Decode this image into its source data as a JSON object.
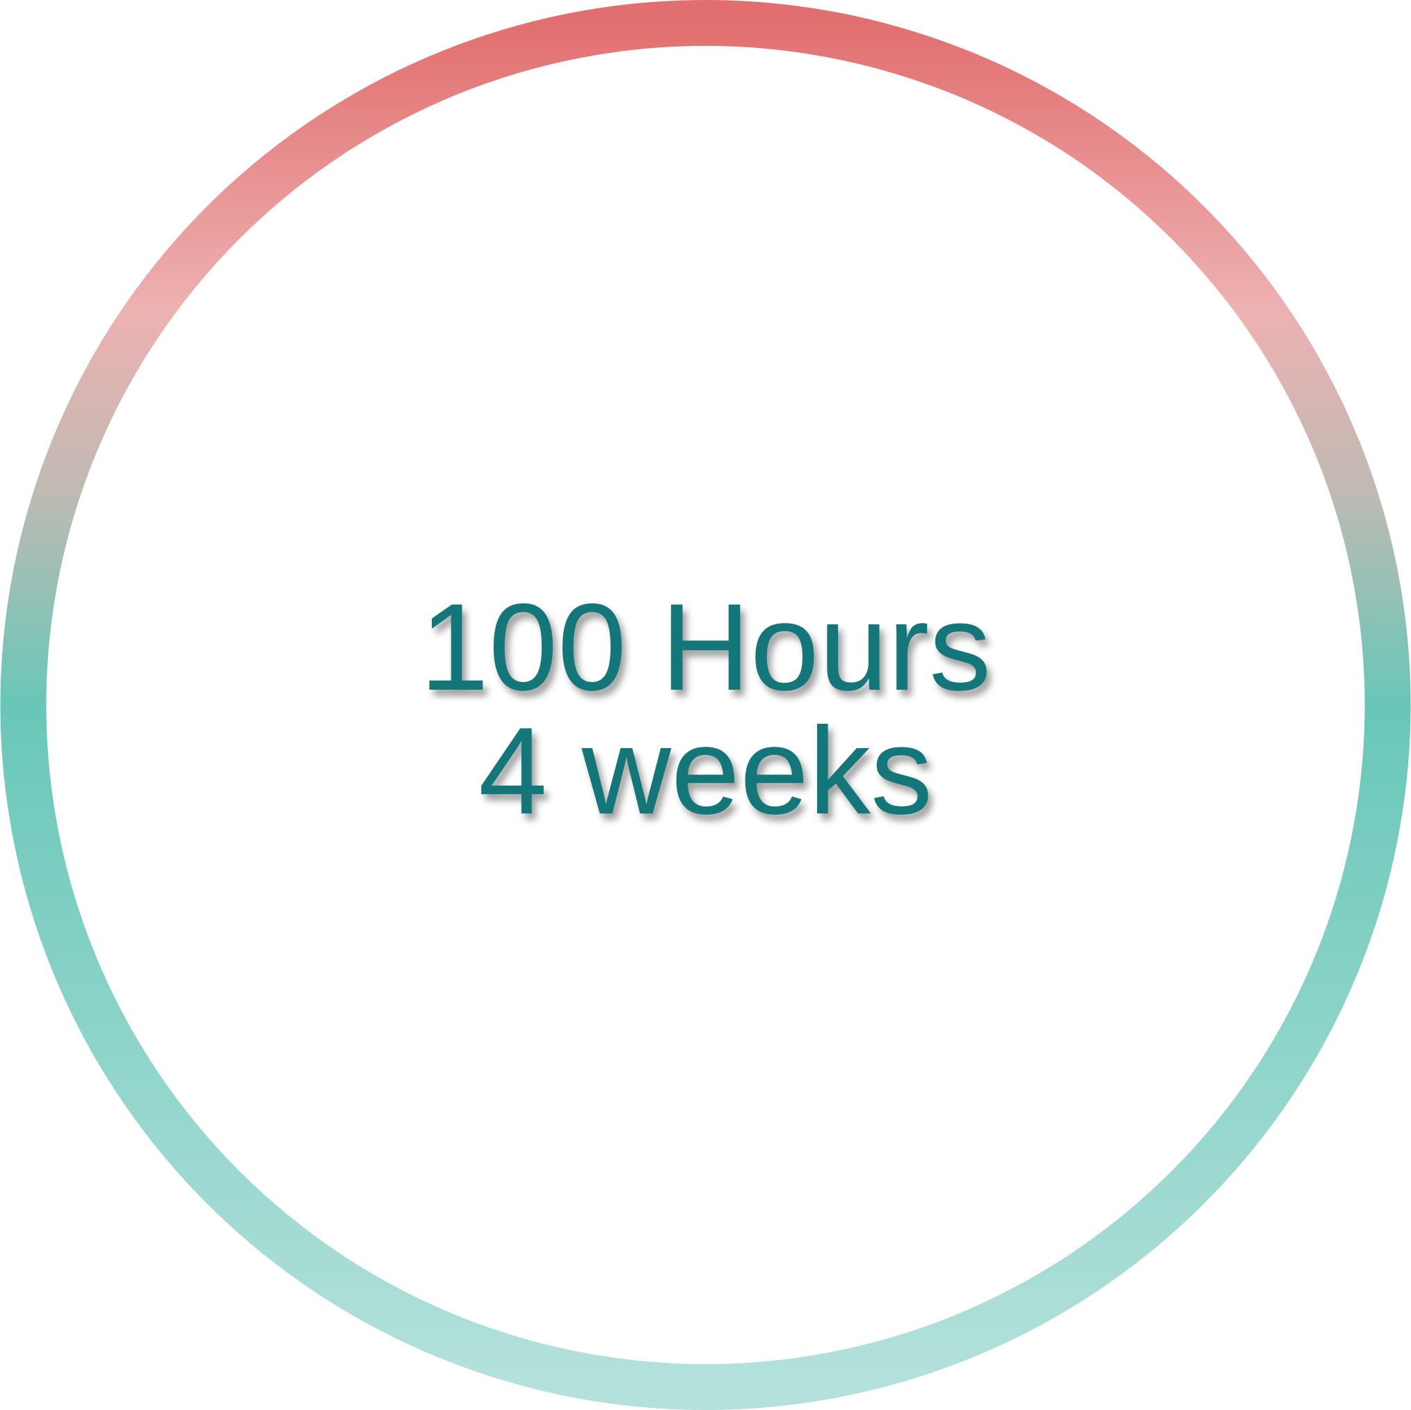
{
  "badge": {
    "primary_text": "100 Hours",
    "secondary_text": "4 weeks",
    "colors": {
      "text": "#13777a",
      "ring_top": "#e26f6f",
      "ring_upper": "#eeb1b1",
      "ring_middle": "#68c7b8",
      "ring_bottom": "#b4e1db",
      "background": "#ffffff"
    }
  }
}
